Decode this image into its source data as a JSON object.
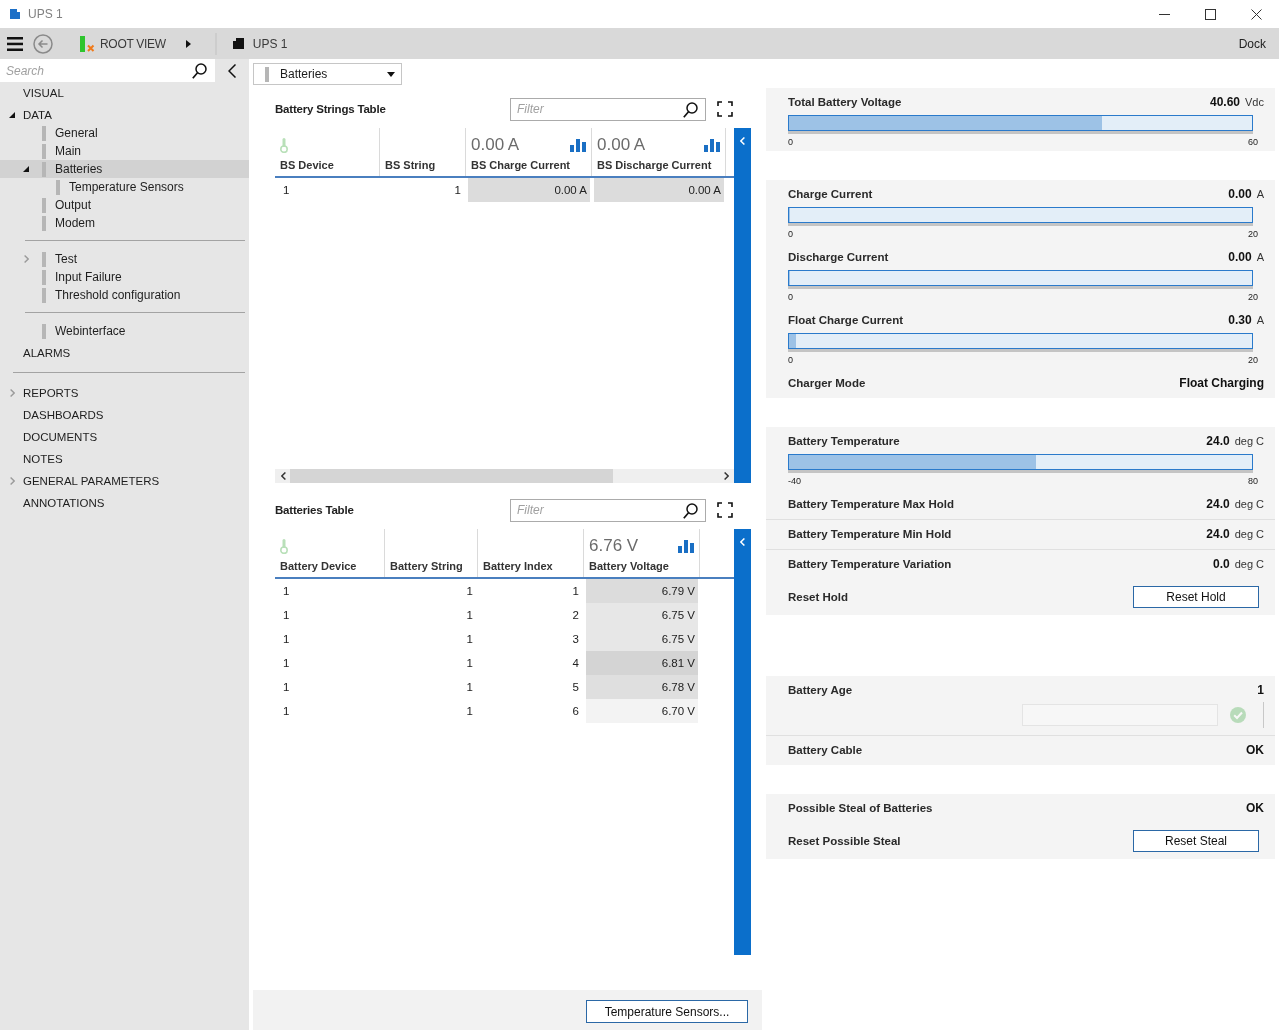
{
  "window": {
    "title": "UPS 1"
  },
  "toolbar": {
    "root_label": "ROOT VIEW",
    "location": "UPS 1",
    "dock": "Dock"
  },
  "sidebar": {
    "search_placeholder": "Search",
    "tree": [
      {
        "label": "VISUAL",
        "selected": false
      },
      {
        "label": "DATA",
        "selected": false,
        "expanded": true,
        "children": [
          {
            "label": "General",
            "selected": false
          },
          {
            "label": "Main",
            "selected": false
          },
          {
            "label": "Batteries",
            "selected": true,
            "expanded": true,
            "children": [
              {
                "label": "Temperature Sensors",
                "selected": false
              }
            ]
          },
          {
            "label": "Output",
            "selected": false
          },
          {
            "label": "Modem",
            "selected": false
          },
          {
            "label": "Test",
            "selected": false,
            "expanded": false,
            "divider": true
          },
          {
            "label": "Input Failure",
            "selected": false
          },
          {
            "label": "Threshold configuration",
            "selected": false
          },
          {
            "label": "Webinterface",
            "selected": false,
            "divider": true
          }
        ]
      },
      {
        "label": "ALARMS",
        "selected": false
      },
      {
        "label": "REPORTS",
        "selected": false,
        "expanded": false,
        "divider": true
      },
      {
        "label": "DASHBOARDS",
        "selected": false
      },
      {
        "label": "DOCUMENTS",
        "selected": false
      },
      {
        "label": "NOTES",
        "selected": false
      },
      {
        "label": "GENERAL PARAMETERS",
        "selected": false,
        "expanded": false
      },
      {
        "label": "ANNOTATIONS",
        "selected": false
      }
    ]
  },
  "view_select": {
    "value": "Batteries"
  },
  "tables": [
    {
      "title": "Battery Strings Table",
      "filter_placeholder": "Filter",
      "scrollbar": true,
      "columns": [
        {
          "kind": "key",
          "label": "BS Device"
        },
        {
          "kind": "plain",
          "label": "BS String"
        },
        {
          "kind": "summary",
          "label": "BS Charge Current",
          "summary": "0.00 A"
        },
        {
          "kind": "summary",
          "label": "BS Discharge Current",
          "summary": "0.00 A"
        }
      ],
      "rows": [
        {
          "cells": [
            {
              "text": "1"
            },
            {
              "text": "1"
            },
            {
              "text": "0.00 A",
              "color": "#dcdcdc"
            },
            {
              "text": "0.00 A",
              "color": "#dcdcdc"
            }
          ]
        }
      ]
    },
    {
      "title": "Batteries Table",
      "filter_placeholder": "Filter",
      "scrollbar": false,
      "columns": [
        {
          "kind": "key",
          "label": "Battery Device"
        },
        {
          "kind": "plain",
          "label": "Battery String"
        },
        {
          "kind": "plain",
          "label": "Battery Index"
        },
        {
          "kind": "summary",
          "label": "Battery Voltage",
          "summary": "6.76 V"
        }
      ],
      "rows": [
        {
          "cells": [
            {
              "text": "1"
            },
            {
              "text": "1"
            },
            {
              "text": "1"
            },
            {
              "text": "6.79 V",
              "color": "#dcdcdc"
            }
          ]
        },
        {
          "cells": [
            {
              "text": "1"
            },
            {
              "text": "1"
            },
            {
              "text": "2"
            },
            {
              "text": "6.75 V",
              "color": "#e7e7e7"
            }
          ]
        },
        {
          "cells": [
            {
              "text": "1"
            },
            {
              "text": "1"
            },
            {
              "text": "3"
            },
            {
              "text": "6.75 V",
              "color": "#e7e7e7"
            }
          ]
        },
        {
          "cells": [
            {
              "text": "1"
            },
            {
              "text": "1"
            },
            {
              "text": "4"
            },
            {
              "text": "6.81 V",
              "color": "#d4d4d4"
            }
          ]
        },
        {
          "cells": [
            {
              "text": "1"
            },
            {
              "text": "1"
            },
            {
              "text": "5"
            },
            {
              "text": "6.78 V",
              "color": "#dfdfdf"
            }
          ]
        },
        {
          "cells": [
            {
              "text": "1"
            },
            {
              "text": "1"
            },
            {
              "text": "6"
            },
            {
              "text": "6.70 V",
              "color": "#f3f3f3"
            }
          ]
        }
      ]
    }
  ],
  "footer": {
    "button": "Temperature Sensors..."
  },
  "cards": [
    {
      "items": [
        {
          "kind": "meter",
          "label": "Total Battery Voltage",
          "value": "40.60",
          "unit": "Vdc",
          "level": 0.677,
          "min": "0",
          "max": "60"
        }
      ]
    },
    {
      "items": [
        {
          "kind": "meter",
          "label": "Charge Current",
          "value": "0.00",
          "unit": "A",
          "level": 0,
          "min": "0",
          "max": "20"
        },
        {
          "kind": "meter",
          "label": "Discharge Current",
          "value": "0.00",
          "unit": "A",
          "level": 0,
          "min": "0",
          "max": "20"
        },
        {
          "kind": "meter",
          "label": "Float Charge Current",
          "value": "0.30",
          "unit": "A",
          "level": 0.015,
          "min": "0",
          "max": "20"
        },
        {
          "kind": "reading",
          "label": "Charger Mode",
          "value": "Float Charging"
        }
      ]
    },
    {
      "items": [
        {
          "kind": "meter",
          "label": "Battery Temperature",
          "value": "24.0",
          "unit": "deg C",
          "level": 0.533,
          "min": "-40",
          "max": "80"
        },
        {
          "kind": "reading",
          "label": "Battery Temperature Max Hold",
          "value": "24.0",
          "unit": "deg C"
        },
        {
          "kind": "reading",
          "label": "Battery Temperature Min Hold",
          "value": "24.0",
          "unit": "deg C",
          "divider": true
        },
        {
          "kind": "reading",
          "label": "Battery Temperature Variation",
          "value": "0.0",
          "unit": "deg C",
          "divider": true
        },
        {
          "kind": "button",
          "label": "Reset Hold",
          "button": "Reset Hold"
        }
      ]
    },
    {
      "items": [
        {
          "kind": "input",
          "label": "Battery Age",
          "value": "1",
          "disabled": true
        },
        {
          "kind": "reading",
          "label": "Battery Cable",
          "value": "OK",
          "divider": true
        }
      ]
    },
    {
      "items": [
        {
          "kind": "reading",
          "label": "Possible Steal of Batteries",
          "value": "OK"
        },
        {
          "kind": "button",
          "label": "Reset Possible Steal",
          "button": "Reset Steal"
        }
      ]
    }
  ]
}
